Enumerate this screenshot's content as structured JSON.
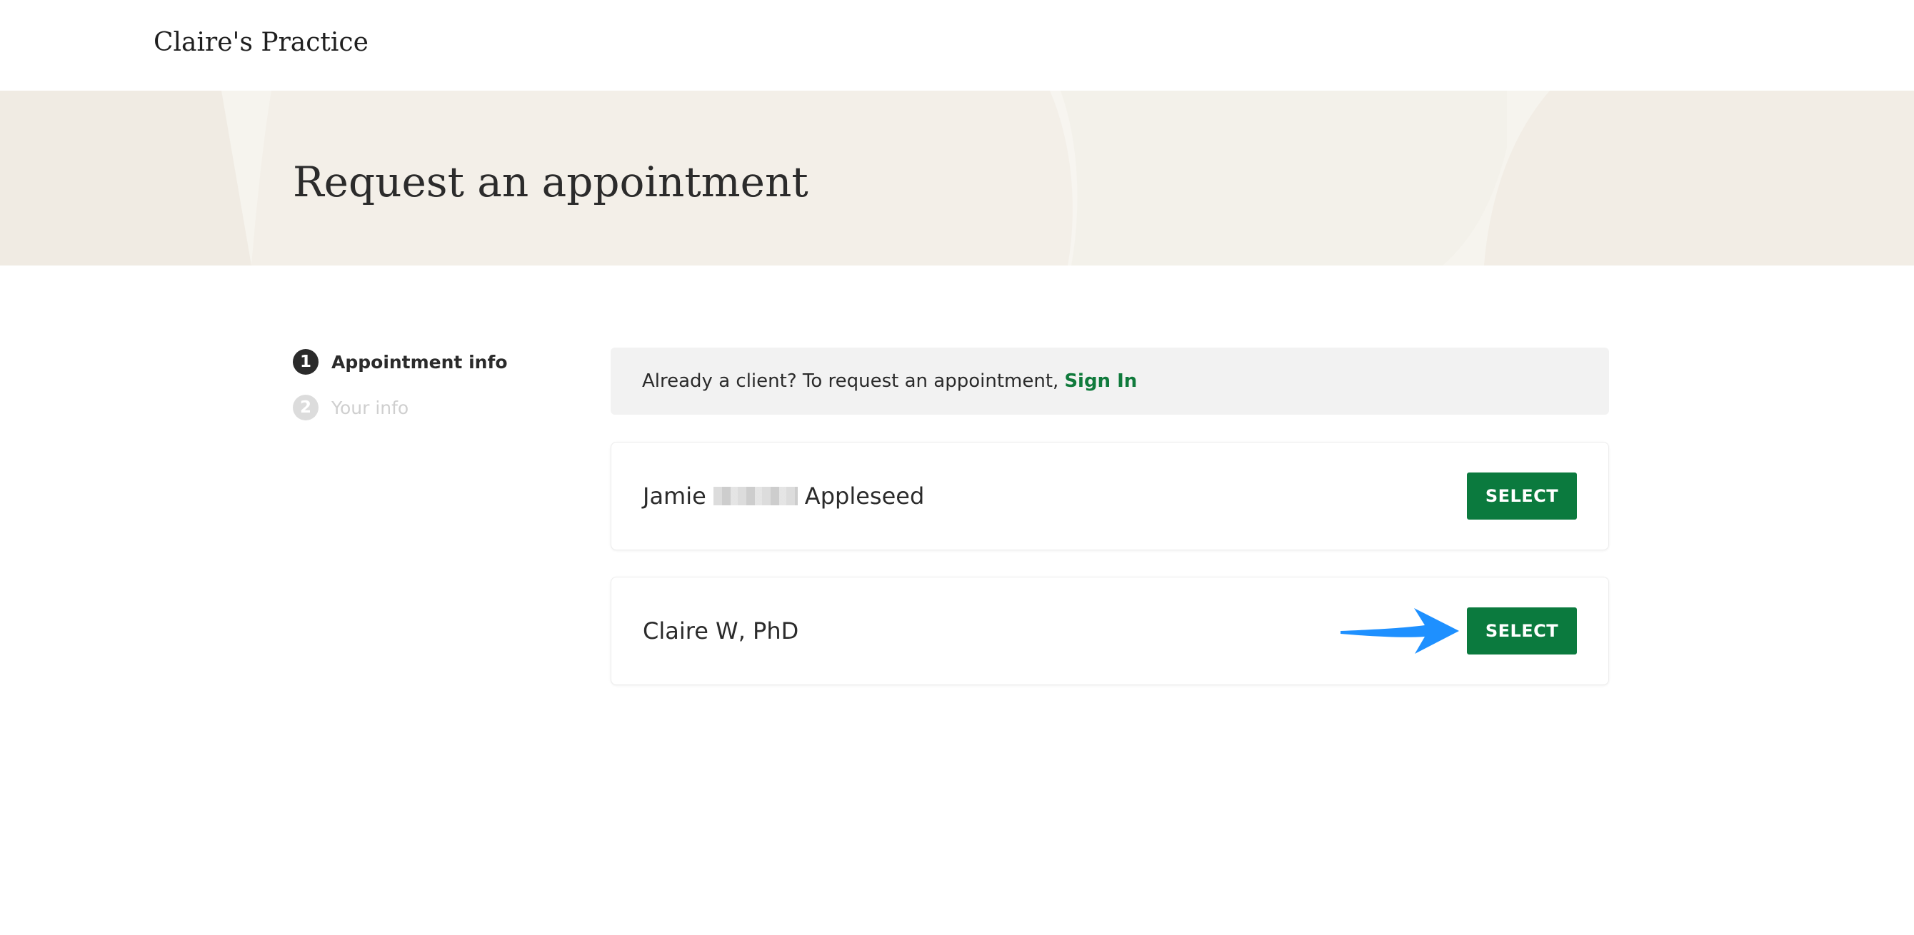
{
  "header": {
    "practice_name": "Claire's Practice"
  },
  "hero": {
    "title": "Request an appointment"
  },
  "steps": [
    {
      "number": "1",
      "label": "Appointment info",
      "state": "active"
    },
    {
      "number": "2",
      "label": "Your info",
      "state": "inactive"
    }
  ],
  "signin_banner": {
    "text": "Already a client? To request an appointment,",
    "link_label": "Sign In"
  },
  "providers": [
    {
      "first": "Jamie",
      "last": "Appleseed",
      "has_redacted_middle": true,
      "button_label": "SELECT"
    },
    {
      "name": "Claire W, PhD",
      "button_label": "SELECT"
    }
  ],
  "colors": {
    "brand_green": "#0b7a3e",
    "link_green": "#107a3c",
    "hero_bg": "#f3efe8",
    "annotation_arrow": "#1e90ff"
  },
  "icons": {
    "annotation": "arrow-right-icon"
  }
}
